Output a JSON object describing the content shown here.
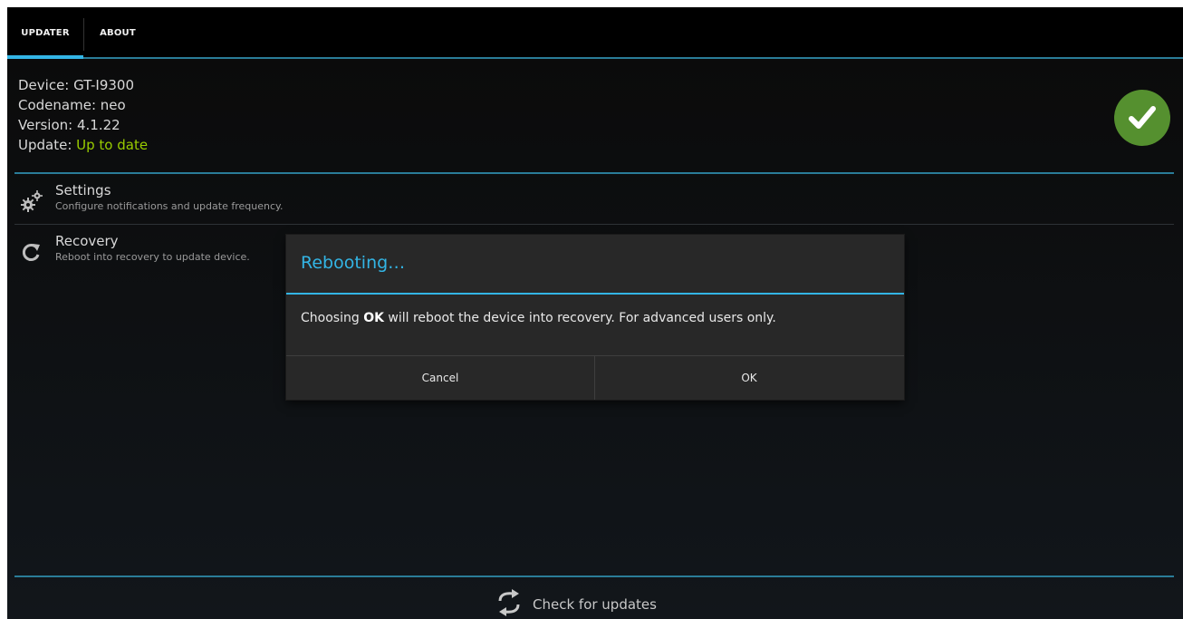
{
  "tabs": [
    {
      "label": "UPDATER",
      "selected": true
    },
    {
      "label": "ABOUT",
      "selected": false
    }
  ],
  "device_info": {
    "device_label": "Device: GT-I9300",
    "codename_label": "Codename: neo",
    "version_label": "Version: 4.1.22",
    "update_prefix": "Update: ",
    "update_status": "Up to date"
  },
  "status_icon": "check-icon",
  "preferences": [
    {
      "title": "Settings",
      "summary": "Configure notifications and update frequency.",
      "icon": "gears-icon"
    },
    {
      "title": "Recovery",
      "summary": "Reboot into recovery to update device.",
      "icon": "refresh-icon"
    }
  ],
  "bottom_action": {
    "label": "Check for updates",
    "icon": "sync-icon"
  },
  "dialog": {
    "title": "Rebooting…",
    "message_prefix": "Choosing ",
    "message_bold": "OK",
    "message_suffix": " will reboot the device into recovery. For advanced users only.",
    "cancel_label": "Cancel",
    "ok_label": "OK"
  },
  "colors": {
    "accent": "#33b5e5",
    "status_green": "#99cc00",
    "badge_green": "#55902f"
  }
}
